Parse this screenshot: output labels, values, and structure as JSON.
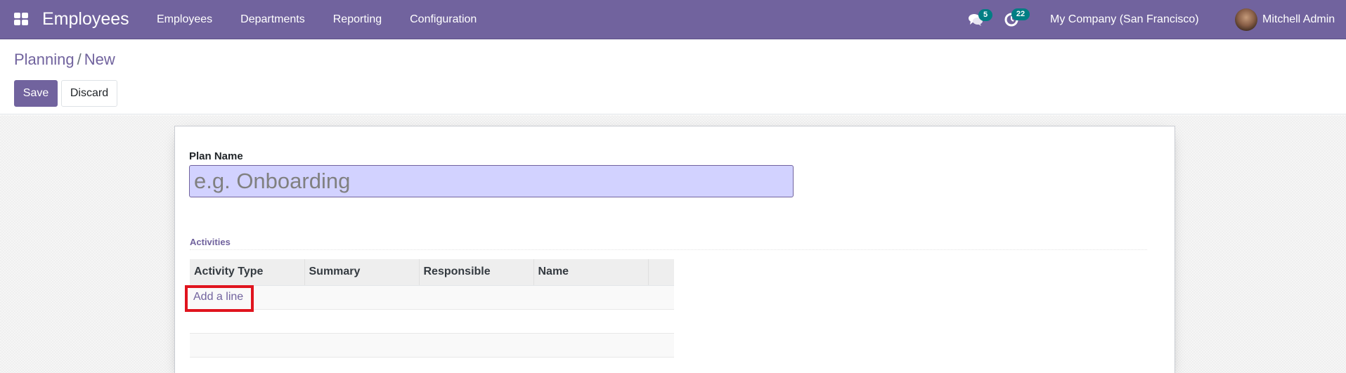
{
  "navbar": {
    "app_icon": "apps-grid-icon",
    "app_name": "Employees",
    "menu": [
      {
        "label": "Employees"
      },
      {
        "label": "Departments"
      },
      {
        "label": "Reporting"
      },
      {
        "label": "Configuration"
      }
    ],
    "systray": {
      "messages_icon": "chat-bubbles-icon",
      "messages_count": "5",
      "activities_icon": "clock-icon",
      "activities_count": "22",
      "company": "My Company (San Francisco)",
      "user_name": "Mitchell Admin"
    },
    "colors": {
      "brand": "#71639e",
      "badge": "#017e84"
    }
  },
  "control_panel": {
    "breadcrumb": [
      {
        "label": "Planning"
      },
      {
        "label": "New"
      }
    ],
    "breadcrumb_separator": "/",
    "save_label": "Save",
    "discard_label": "Discard"
  },
  "form": {
    "plan_name_label": "Plan Name",
    "plan_name_value": "",
    "plan_name_placeholder": "e.g. Onboarding",
    "activities_section_title": "Activities",
    "activities_table": {
      "columns": [
        "Activity Type",
        "Summary",
        "Responsible",
        "Name"
      ],
      "rows": [],
      "add_line_label": "Add a line"
    }
  },
  "annotation": {
    "highlight_color": "#e0141e",
    "highlighted_element": "Add a line"
  }
}
